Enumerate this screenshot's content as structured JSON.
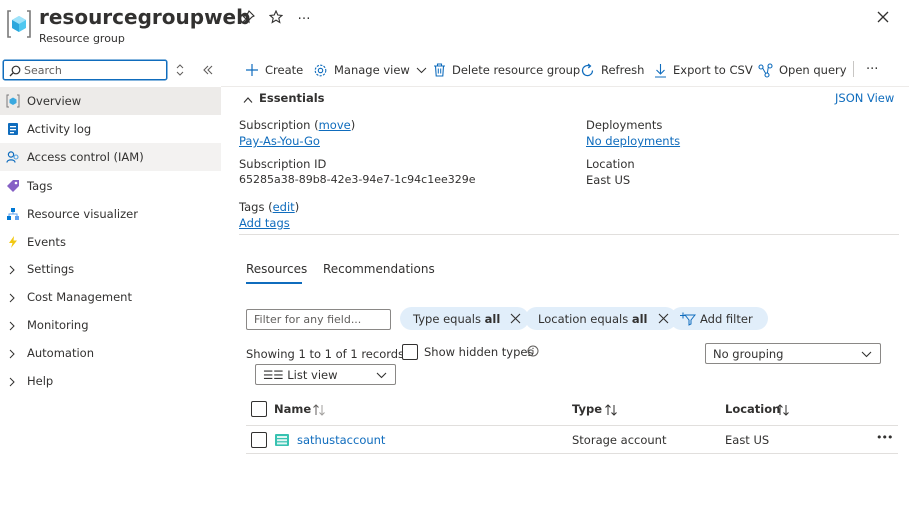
{
  "header": {
    "title": "resourcegroupweb",
    "subtitle": "Resource group",
    "pin_icon": "pin-icon",
    "star_icon": "star-icon",
    "more_label": "…",
    "close_icon": "close-icon"
  },
  "sidebar": {
    "search_placeholder": "Search",
    "items": [
      {
        "label": "Overview",
        "icon": "resource-group-icon",
        "state": "active"
      },
      {
        "label": "Activity log",
        "icon": "activity-log-icon"
      },
      {
        "label": "Access control (IAM)",
        "icon": "people-icon",
        "state": "hover"
      },
      {
        "label": "Tags",
        "icon": "tag-icon"
      },
      {
        "label": "Resource visualizer",
        "icon": "hierarchy-icon"
      },
      {
        "label": "Events",
        "icon": "lightning-icon"
      },
      {
        "label": "Settings",
        "icon": "chevron-right-icon"
      },
      {
        "label": "Cost Management",
        "icon": "chevron-right-icon"
      },
      {
        "label": "Monitoring",
        "icon": "chevron-right-icon"
      },
      {
        "label": "Automation",
        "icon": "chevron-right-icon"
      },
      {
        "label": "Help",
        "icon": "chevron-right-icon"
      }
    ]
  },
  "toolbar": {
    "create": "Create",
    "manage_view": "Manage view",
    "delete": "Delete resource group",
    "refresh": "Refresh",
    "export": "Export to CSV",
    "open_query": "Open query",
    "more": "···"
  },
  "essentials": {
    "title": "Essentials",
    "json_view": "JSON View",
    "subscription_label": "Subscription (",
    "subscription_move": "move",
    "subscription_close": ")",
    "subscription_value": "Pay-As-You-Go",
    "subscription_id_label": "Subscription ID",
    "subscription_id_value": "65285a38-89b8-42e3-94e7-1c94c1ee329e",
    "tags_label": "Tags (",
    "tags_edit": "edit",
    "tags_close": ")",
    "tags_value": "Add tags",
    "deployments_label": "Deployments",
    "deployments_value": "No deployments",
    "location_label": "Location",
    "location_value": "East US"
  },
  "tabs": {
    "resources": "Resources",
    "recommendations": "Recommendations"
  },
  "filters": {
    "placeholder": "Filter for any field...",
    "type_prefix": "Type equals ",
    "type_value": "all",
    "location_prefix": "Location equals ",
    "location_value": "all",
    "add_filter": "Add filter"
  },
  "records": {
    "showing": "Showing 1 to 1 of 1 records.",
    "show_hidden": "Show hidden types",
    "grouping": "No grouping",
    "view": "☰☰ List view"
  },
  "table": {
    "columns": [
      "Name",
      "Type",
      "Location"
    ],
    "rows": [
      {
        "name": "sathustaccount",
        "type": "Storage account",
        "location": "East US",
        "more": "•••"
      }
    ]
  },
  "colors": {
    "accent": "#0f6cbd",
    "pill_bg": "#e1eefa",
    "active_nav": "#edebe9"
  }
}
